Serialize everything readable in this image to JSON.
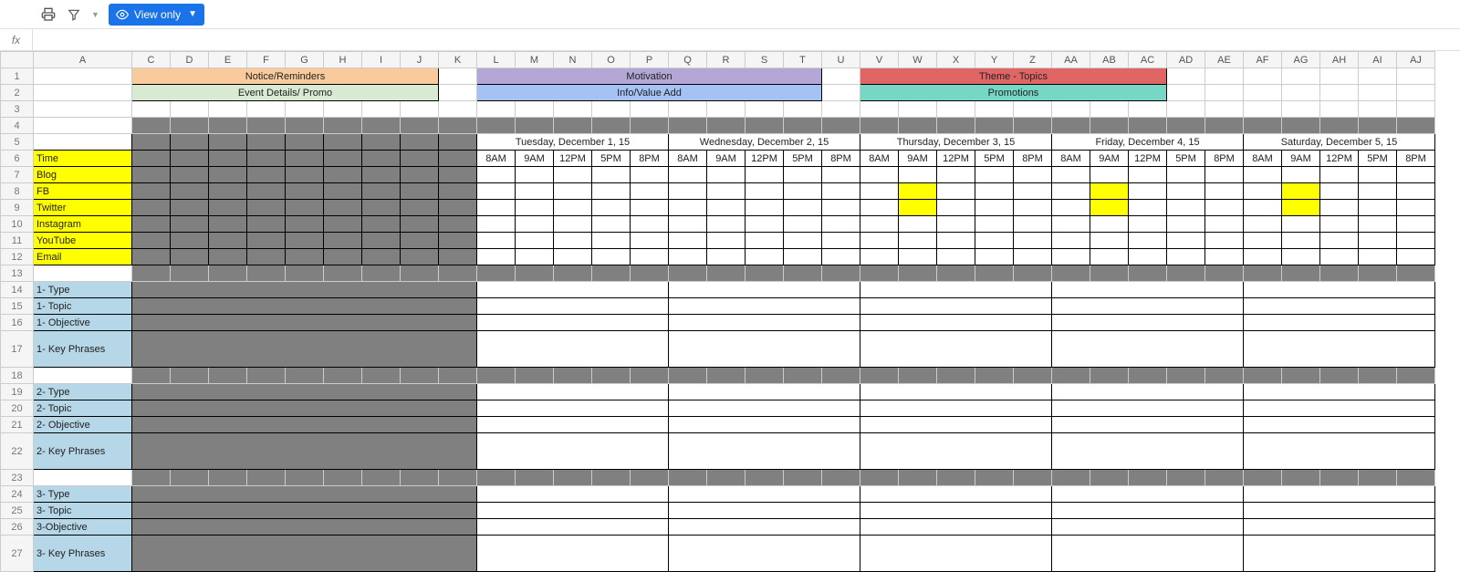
{
  "toolbar": {
    "view_only": "View only"
  },
  "fx": "fx",
  "col_headers": [
    "A",
    "C",
    "D",
    "E",
    "F",
    "G",
    "H",
    "I",
    "J",
    "K",
    "L",
    "M",
    "N",
    "O",
    "P",
    "Q",
    "R",
    "S",
    "T",
    "U",
    "V",
    "W",
    "X",
    "Y",
    "Z",
    "AA",
    "AB",
    "AC",
    "AD",
    "AE",
    "AF",
    "AG",
    "AH",
    "AI",
    "AJ"
  ],
  "legend": {
    "notice": "Notice/Reminders",
    "event": "Event Details/ Promo",
    "motivation": "Motivation",
    "info": "Info/Value Add",
    "theme": "Theme - Topics",
    "promo": "Promotions"
  },
  "days": [
    "Tuesday, December 1, 15",
    "Wednesday, December 2, 15",
    "Thursday, December 3, 15",
    "Friday, December 4, 15",
    "Saturday, December 5, 15"
  ],
  "times": [
    "8AM",
    "9AM",
    "12PM",
    "5PM",
    "8PM"
  ],
  "labels": {
    "time": "Time",
    "blog": "Blog",
    "fb": "FB",
    "tw": "Twitter",
    "ig": "Instagram",
    "yt": "YouTube",
    "em": "Email",
    "t1": "1- Type",
    "p1": "1- Topic",
    "o1": "1- Objective",
    "k1": "1- Key Phrases",
    "t2": "2- Type",
    "p2": "2- Topic",
    "o2": "2- Objective",
    "k2": "2- Key Phrases",
    "t3": "3- Type",
    "p3": "3- Topic",
    "o3": "3-Objective",
    "k3": "3- Key Phrases"
  },
  "row_nums": {
    "r1": "1",
    "r2": "2",
    "r3": "3",
    "r4": "4",
    "r5": "5",
    "r6": "6",
    "r7": "7",
    "r8": "8",
    "r9": "9",
    "r10": "10",
    "r11": "11",
    "r12": "12",
    "r13": "13",
    "r14": "14",
    "r15": "15",
    "r16": "16",
    "r17": "17",
    "r18": "18",
    "r19": "19",
    "r20": "20",
    "r21": "21",
    "r22": "22",
    "r23": "23",
    "r24": "24",
    "r25": "25",
    "r26": "26",
    "r27": "27"
  },
  "yellow_cells": [
    {
      "row": 8,
      "col": 22
    },
    {
      "row": 8,
      "col": 27
    },
    {
      "row": 8,
      "col": 32
    },
    {
      "row": 9,
      "col": 22
    },
    {
      "row": 9,
      "col": 27
    },
    {
      "row": 9,
      "col": 32
    }
  ]
}
